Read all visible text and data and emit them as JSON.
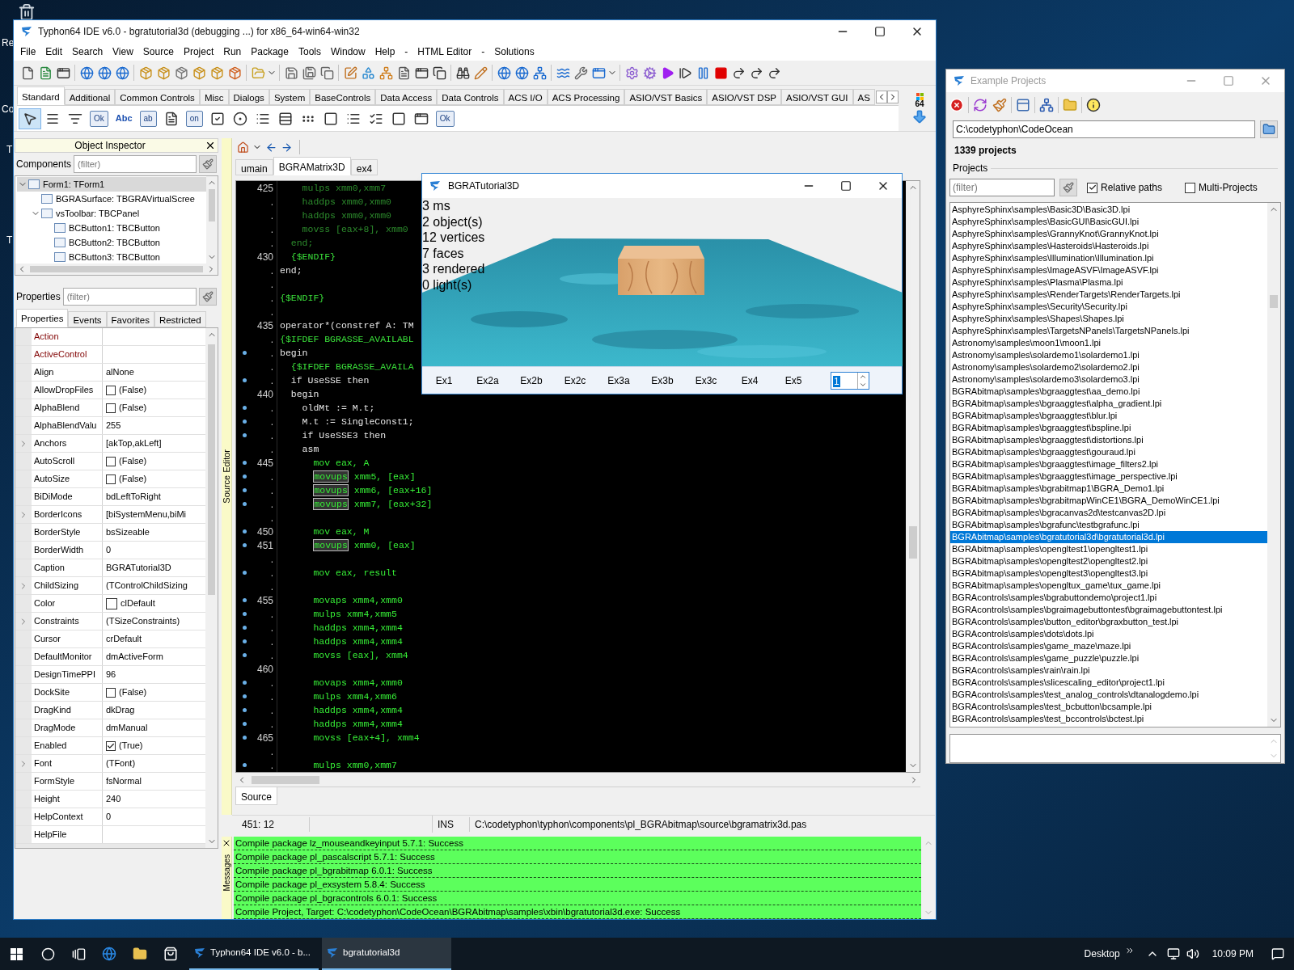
{
  "desktop": {
    "icon_labels": [
      "Re",
      "Co",
      "T",
      "T"
    ]
  },
  "ide": {
    "title": "Typhon64 IDE v6.0 - bgratutorial3d (debugging ...) for x86_64-win64-win32",
    "menu": [
      "File",
      "Edit",
      "Search",
      "View",
      "Source",
      "Project",
      "Run",
      "Package",
      "Tools",
      "Window",
      "Help",
      "-",
      "HTML Editor",
      "-",
      "Solutions"
    ],
    "palette_tabs": [
      {
        "label": "Standard",
        "selected": true
      },
      {
        "label": "Additional",
        "selected": false
      },
      {
        "label": "Common Controls",
        "selected": false
      },
      {
        "label": "Misc",
        "selected": false
      },
      {
        "label": "Dialogs",
        "selected": false
      },
      {
        "label": "System",
        "selected": false
      },
      {
        "label": "BaseControls",
        "selected": false
      },
      {
        "label": "Data Access",
        "selected": false
      },
      {
        "label": "Data Controls",
        "selected": false
      },
      {
        "label": "ACS I/O",
        "selected": false
      },
      {
        "label": "ACS Processing",
        "selected": false
      },
      {
        "label": "ASIO/VST Basics",
        "selected": false
      },
      {
        "label": "ASIO/VST DSP",
        "selected": false
      },
      {
        "label": "ASIO/VST GUI",
        "selected": false
      },
      {
        "label": "AS",
        "selected": false
      }
    ],
    "palette_items": [
      {
        "kind": "pointer",
        "selected": true
      },
      {
        "kind": "menu",
        "selected": false
      },
      {
        "kind": "popup",
        "selected": false
      },
      {
        "kind": "button",
        "label": "Ok",
        "selected": false
      },
      {
        "kind": "label",
        "label": "Abc",
        "selected": false
      },
      {
        "kind": "edit",
        "label": "ab",
        "selected": false
      },
      {
        "kind": "memo",
        "selected": false
      },
      {
        "kind": "toggle",
        "label": "on",
        "selected": false
      },
      {
        "kind": "check",
        "selected": false
      },
      {
        "kind": "radio",
        "selected": false
      },
      {
        "kind": "list",
        "selected": false
      },
      {
        "kind": "combo",
        "selected": false
      },
      {
        "kind": "scroll",
        "selected": false
      },
      {
        "kind": "panel",
        "selected": false
      },
      {
        "kind": "list",
        "selected": false
      },
      {
        "kind": "checkgroup",
        "selected": false
      },
      {
        "kind": "panel",
        "selected": false
      },
      {
        "kind": "frame",
        "selected": false
      },
      {
        "kind": "button",
        "label": "Ok",
        "selected": false
      }
    ],
    "palette_badge": "64",
    "object_inspector": {
      "title": "Object Inspector",
      "components_label": "Components",
      "components_filter_placeholder": "(filter)",
      "tree": [
        {
          "label": "Form1: TForm1",
          "selected": true,
          "expanded": true,
          "children": [
            {
              "label": "BGRASurface: TBGRAVirtualScree",
              "selected": false
            },
            {
              "label": "vsToolbar: TBCPanel",
              "selected": false,
              "expanded": true,
              "children": [
                {
                  "label": "BCButton1: TBCButton",
                  "selected": false
                },
                {
                  "label": "BCButton2: TBCButton",
                  "selected": false
                },
                {
                  "label": "BCButton3: TBCButton",
                  "selected": false
                }
              ]
            }
          ]
        }
      ],
      "properties_label": "Properties",
      "properties_filter_placeholder": "(filter)",
      "tabs": [
        {
          "label": "Properties",
          "selected": true
        },
        {
          "label": "Events",
          "selected": false
        },
        {
          "label": "Favorites",
          "selected": false
        },
        {
          "label": "Restricted",
          "selected": false
        }
      ],
      "properties": [
        {
          "name": "Action",
          "kind": "reference",
          "expandable": false
        },
        {
          "name": "ActiveControl",
          "kind": "reference",
          "expandable": false
        },
        {
          "name": "Align",
          "value": "alNone",
          "kind": "text",
          "expandable": false
        },
        {
          "name": "AllowDropFiles",
          "value": "(False)",
          "kind": "check",
          "checked": false,
          "expandable": false
        },
        {
          "name": "AlphaBlend",
          "value": "(False)",
          "kind": "check",
          "checked": false,
          "expandable": false
        },
        {
          "name": "AlphaBlendValu",
          "value": "255",
          "kind": "text",
          "expandable": false
        },
        {
          "name": "Anchors",
          "value": "[akTop,akLeft]",
          "kind": "text",
          "expandable": true
        },
        {
          "name": "AutoScroll",
          "value": "(False)",
          "kind": "check",
          "checked": false,
          "expandable": false
        },
        {
          "name": "AutoSize",
          "value": "(False)",
          "kind": "check",
          "checked": false,
          "expandable": false
        },
        {
          "name": "BiDiMode",
          "value": "bdLeftToRight",
          "kind": "text",
          "expandable": false
        },
        {
          "name": "BorderIcons",
          "value": "[biSystemMenu,biMi",
          "kind": "text",
          "expandable": true
        },
        {
          "name": "BorderStyle",
          "value": "bsSizeable",
          "kind": "text",
          "expandable": false
        },
        {
          "name": "BorderWidth",
          "value": "0",
          "kind": "text",
          "expandable": false
        },
        {
          "name": "Caption",
          "value": "BGRATutorial3D",
          "kind": "text",
          "expandable": false
        },
        {
          "name": "ChildSizing",
          "value": "(TControlChildSizing",
          "kind": "text",
          "expandable": true
        },
        {
          "name": "Color",
          "value": "clDefault",
          "kind": "color",
          "expandable": false
        },
        {
          "name": "Constraints",
          "value": "(TSizeConstraints)",
          "kind": "text",
          "expandable": true
        },
        {
          "name": "Cursor",
          "value": "crDefault",
          "kind": "text",
          "expandable": false
        },
        {
          "name": "DefaultMonitor",
          "value": "dmActiveForm",
          "kind": "text",
          "expandable": false
        },
        {
          "name": "DesignTimePPI",
          "value": "96",
          "kind": "text",
          "expandable": false
        },
        {
          "name": "DockSite",
          "value": "(False)",
          "kind": "check",
          "checked": false,
          "expandable": false
        },
        {
          "name": "DragKind",
          "value": "dkDrag",
          "kind": "text",
          "expandable": false
        },
        {
          "name": "DragMode",
          "value": "dmManual",
          "kind": "text",
          "expandable": false
        },
        {
          "name": "Enabled",
          "value": "(True)",
          "kind": "check",
          "checked": true,
          "expandable": false
        },
        {
          "name": "Font",
          "value": "(TFont)",
          "kind": "text",
          "expandable": true
        },
        {
          "name": "FormStyle",
          "value": "fsNormal",
          "kind": "text",
          "expandable": false
        },
        {
          "name": "Height",
          "value": "240",
          "kind": "text",
          "expandable": false
        },
        {
          "name": "HelpContext",
          "value": "0",
          "kind": "text",
          "expandable": false
        },
        {
          "name": "HelpFile",
          "kind": "text",
          "expandable": false
        }
      ]
    },
    "editor": {
      "side_label": "Source Editor",
      "tabs": [
        {
          "label": "umain",
          "selected": false
        },
        {
          "label": "BGRAMatrix3D",
          "selected": true
        },
        {
          "label": "ex4",
          "selected": false
        }
      ],
      "lines": [
        {
          "n": "425",
          "dot": false,
          "kind": "inactive",
          "text": "    mulps xmm0,xmm7"
        },
        {
          "n": ".",
          "dot": false,
          "kind": "inactive",
          "text": "    haddps xmm0,xmm0"
        },
        {
          "n": ".",
          "dot": false,
          "kind": "inactive",
          "text": "    haddps xmm0,xmm0"
        },
        {
          "n": ".",
          "dot": false,
          "kind": "inactive",
          "text": "    movss [eax+8], xmm0"
        },
        {
          "n": ".",
          "dot": false,
          "kind": "inactive",
          "text": "  end;"
        },
        {
          "n": "430",
          "dot": false,
          "kind": "directive",
          "text": "  {$ENDIF}"
        },
        {
          "n": ".",
          "dot": false,
          "kind": "pascal",
          "text": "end;"
        },
        {
          "n": ".",
          "dot": false
        },
        {
          "n": ".",
          "dot": false,
          "kind": "directive",
          "text": "{$ENDIF}"
        },
        {
          "n": ".",
          "dot": false
        },
        {
          "n": "435",
          "dot": false,
          "kind": "pascal",
          "text": "operator*(constref A: TM"
        },
        {
          "n": ".",
          "dot": false,
          "kind": "directive",
          "text": "{$IFDEF BGRASSE_AVAILABL"
        },
        {
          "n": ".",
          "dot": true,
          "kind": "pascal",
          "text": "begin"
        },
        {
          "n": ".",
          "dot": false,
          "kind": "directive",
          "text": "  {$IFDEF BGRASSE_AVAILA"
        },
        {
          "n": ".",
          "dot": true,
          "kind": "pascal",
          "text": "  if UseSSE then"
        },
        {
          "n": "440",
          "dot": false,
          "kind": "pascal",
          "text": "  begin"
        },
        {
          "n": ".",
          "dot": true,
          "kind": "pascal",
          "text": "    oldMt := M.t;"
        },
        {
          "n": ".",
          "dot": true,
          "kind": "pascal",
          "text": "    M.t := SingleConst1;"
        },
        {
          "n": ".",
          "dot": true,
          "kind": "pascal",
          "text": "    if UseSSE3 then"
        },
        {
          "n": ".",
          "dot": false,
          "kind": "pascal",
          "text": "    asm"
        },
        {
          "n": "445",
          "dot": true,
          "kind": "asm",
          "text": "      mov eax, A"
        },
        {
          "n": ".",
          "dot": true,
          "kind": "asm",
          "boxed": "movups",
          "text": " xmm5, [eax]"
        },
        {
          "n": ".",
          "dot": true,
          "kind": "asm",
          "boxed": "movups",
          "text": " xmm6, [eax+16]"
        },
        {
          "n": ".",
          "dot": true,
          "kind": "asm",
          "boxed": "movups",
          "text": " xmm7, [eax+32]"
        },
        {
          "n": ".",
          "dot": false
        },
        {
          "n": "450",
          "dot": true,
          "kind": "asm",
          "text": "      mov eax, M"
        },
        {
          "n": "451",
          "dot": true,
          "kind": "asm",
          "boxed": "movups",
          "text": " xmm0, [eax]"
        },
        {
          "n": ".",
          "dot": false
        },
        {
          "n": ".",
          "dot": true,
          "kind": "asm",
          "text": "      mov eax, result"
        },
        {
          "n": ".",
          "dot": false
        },
        {
          "n": "455",
          "dot": true,
          "kind": "asm",
          "text": "      movaps xmm4,xmm0"
        },
        {
          "n": ".",
          "dot": true,
          "kind": "asm",
          "text": "      mulps xmm4,xmm5"
        },
        {
          "n": ".",
          "dot": true,
          "kind": "asm",
          "text": "      haddps xmm4,xmm4"
        },
        {
          "n": ".",
          "dot": true,
          "kind": "asm",
          "text": "      haddps xmm4,xmm4"
        },
        {
          "n": ".",
          "dot": true,
          "kind": "asm",
          "text": "      movss [eax], xmm4"
        },
        {
          "n": "460",
          "dot": false
        },
        {
          "n": ".",
          "dot": true,
          "kind": "asm",
          "text": "      movaps xmm4,xmm0"
        },
        {
          "n": ".",
          "dot": true,
          "kind": "asm",
          "text": "      mulps xmm4,xmm6"
        },
        {
          "n": ".",
          "dot": true,
          "kind": "asm",
          "text": "      haddps xmm4,xmm4"
        },
        {
          "n": ".",
          "dot": true,
          "kind": "asm",
          "text": "      haddps xmm4,xmm4"
        },
        {
          "n": "465",
          "dot": true,
          "kind": "asm",
          "text": "      movss [eax+4], xmm4"
        },
        {
          "n": ".",
          "dot": false
        },
        {
          "n": ".",
          "dot": true,
          "kind": "asm",
          "text": "      mulps xmm0,xmm7"
        }
      ],
      "bottom_tab": "Source",
      "status": {
        "position": "451: 12",
        "mode": "INS",
        "file": "C:\\codetyphon\\typhon\\components\\pl_BGRAbitmap\\source\\bgramatrix3d.pas"
      }
    },
    "messages": {
      "side_label": "Messages",
      "lines": [
        "Compile package lz_mouseandkeyinput 5.7.1: Success",
        "Compile package pl_pascalscript 5.7.1: Success",
        "Compile package pl_bgrabitmap 6.0.1: Success",
        "Compile package pl_exsystem 5.8.4: Success",
        "Compile package pl_bgracontrols 6.0.1: Success",
        "Compile Project, Target: C:\\codetyphon\\CodeOcean\\BGRAbitmap\\samples\\xbin\\bgratutorial3d.exe: Success"
      ]
    }
  },
  "demo_window": {
    "title": "BGRATutorial3D",
    "stats": [
      "3 ms",
      "2 object(s)",
      "12 vertices",
      "7 faces",
      "3 rendered",
      "0 light(s)"
    ],
    "buttons": [
      "Ex1",
      "Ex2a",
      "Ex2b",
      "Ex2c",
      "Ex3a",
      "Ex3b",
      "Ex3c",
      "Ex4",
      "Ex5"
    ],
    "spin_value": "1"
  },
  "example_projects": {
    "title": "Example Projects",
    "path": "C:\\codetyphon\\CodeOcean",
    "count": "1339 projects",
    "group_label": "Projects",
    "filter_placeholder": "(filter)",
    "options": [
      {
        "label": "Relative paths",
        "checked": true
      },
      {
        "label": "Multi-Projects",
        "checked": false
      }
    ],
    "items": [
      {
        "label": "AsphyreSphinx\\samples\\Basic3D\\Basic3D.lpi",
        "selected": false
      },
      {
        "label": "AsphyreSphinx\\samples\\BasicGUI\\BasicGUI.lpi",
        "selected": false
      },
      {
        "label": "AsphyreSphinx\\samples\\GrannyKnot\\GrannyKnot.lpi",
        "selected": false
      },
      {
        "label": "AsphyreSphinx\\samples\\Hasteroids\\Hasteroids.lpi",
        "selected": false
      },
      {
        "label": "AsphyreSphinx\\samples\\Illumination\\Illumination.lpi",
        "selected": false
      },
      {
        "label": "AsphyreSphinx\\samples\\ImageASVF\\ImageASVF.lpi",
        "selected": false
      },
      {
        "label": "AsphyreSphinx\\samples\\Plasma\\Plasma.lpi",
        "selected": false
      },
      {
        "label": "AsphyreSphinx\\samples\\RenderTargets\\RenderTargets.lpi",
        "selected": false
      },
      {
        "label": "AsphyreSphinx\\samples\\Security\\Security.lpi",
        "selected": false
      },
      {
        "label": "AsphyreSphinx\\samples\\Shapes\\Shapes.lpi",
        "selected": false
      },
      {
        "label": "AsphyreSphinx\\samples\\TargetsNPanels\\TargetsNPanels.lpi",
        "selected": false
      },
      {
        "label": "Astronomy\\samples\\moon1\\moon1.lpi",
        "selected": false
      },
      {
        "label": "Astronomy\\samples\\solardemo1\\solardemo1.lpi",
        "selected": false
      },
      {
        "label": "Astronomy\\samples\\solardemo2\\solardemo2.lpi",
        "selected": false
      },
      {
        "label": "Astronomy\\samples\\solardemo3\\solardemo3.lpi",
        "selected": false
      },
      {
        "label": "BGRAbitmap\\samples\\bgraaggtest\\aa_demo.lpi",
        "selected": false
      },
      {
        "label": "BGRAbitmap\\samples\\bgraaggtest\\alpha_gradient.lpi",
        "selected": false
      },
      {
        "label": "BGRAbitmap\\samples\\bgraaggtest\\blur.lpi",
        "selected": false
      },
      {
        "label": "BGRAbitmap\\samples\\bgraaggtest\\bspline.lpi",
        "selected": false
      },
      {
        "label": "BGRAbitmap\\samples\\bgraaggtest\\distortions.lpi",
        "selected": false
      },
      {
        "label": "BGRAbitmap\\samples\\bgraaggtest\\gouraud.lpi",
        "selected": false
      },
      {
        "label": "BGRAbitmap\\samples\\bgraaggtest\\image_filters2.lpi",
        "selected": false
      },
      {
        "label": "BGRAbitmap\\samples\\bgraaggtest\\image_perspective.lpi",
        "selected": false
      },
      {
        "label": "BGRAbitmap\\samples\\bgrabitmap1\\BGRA_Demo1.lpi",
        "selected": false
      },
      {
        "label": "BGRAbitmap\\samples\\bgrabitmapWinCE1\\BGRA_DemoWinCE1.lpi",
        "selected": false
      },
      {
        "label": "BGRAbitmap\\samples\\bgracanvas2d\\testcanvas2D.lpi",
        "selected": false
      },
      {
        "label": "BGRAbitmap\\samples\\bgrafunc\\testbgrafunc.lpi",
        "selected": false
      },
      {
        "label": "BGRAbitmap\\samples\\bgratutorial3d\\bgratutorial3d.lpi",
        "selected": true
      },
      {
        "label": "BGRAbitmap\\samples\\opengltest1\\opengltest1.lpi",
        "selected": false
      },
      {
        "label": "BGRAbitmap\\samples\\opengltest2\\opengltest2.lpi",
        "selected": false
      },
      {
        "label": "BGRAbitmap\\samples\\opengltest3\\opengltest3.lpi",
        "selected": false
      },
      {
        "label": "BGRAbitmap\\samples\\opengltux_game\\tux_game.lpi",
        "selected": false
      },
      {
        "label": "BGRAcontrols\\samples\\bgrabuttondemo\\project1.lpi",
        "selected": false
      },
      {
        "label": "BGRAcontrols\\samples\\bgraimagebuttontest\\bgraimagebuttontest.lpi",
        "selected": false
      },
      {
        "label": "BGRAcontrols\\samples\\button_editor\\bgraxbutton_test.lpi",
        "selected": false
      },
      {
        "label": "BGRAcontrols\\samples\\dots\\dots.lpi",
        "selected": false
      },
      {
        "label": "BGRAcontrols\\samples\\game_maze\\maze.lpi",
        "selected": false
      },
      {
        "label": "BGRAcontrols\\samples\\game_puzzle\\puzzle.lpi",
        "selected": false
      },
      {
        "label": "BGRAcontrols\\samples\\rain\\rain.lpi",
        "selected": false
      },
      {
        "label": "BGRAcontrols\\samples\\slicescaling_editor\\project1.lpi",
        "selected": false
      },
      {
        "label": "BGRAcontrols\\samples\\test_analog_controls\\dtanalogdemo.lpi",
        "selected": false
      },
      {
        "label": "BGRAcontrols\\samples\\test_bcbutton\\bcsample.lpi",
        "selected": false
      },
      {
        "label": "BGRAcontrols\\samples\\test_bccontrols\\bctest.lpi",
        "selected": false
      }
    ]
  },
  "taskbar": {
    "tasks": [
      {
        "label": "Typhon64 IDE v6.0 - b...",
        "selected": false
      },
      {
        "label": "bgratutorial3d",
        "selected": true
      }
    ],
    "desktop_label": "Desktop",
    "time": "10:09 PM"
  }
}
